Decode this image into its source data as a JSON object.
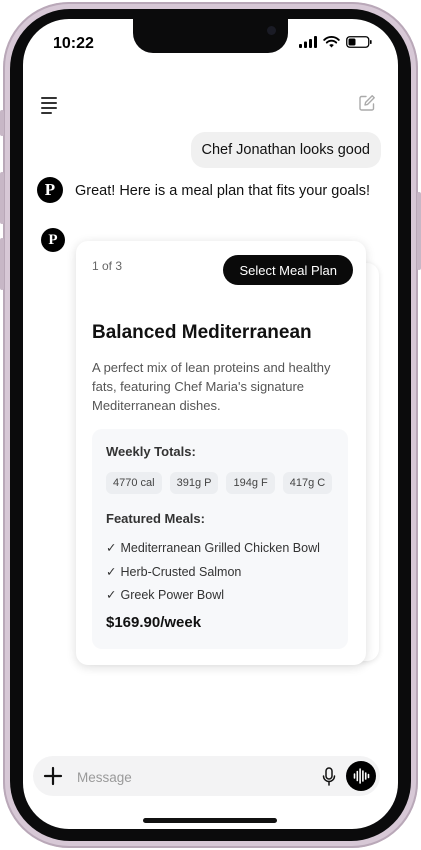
{
  "status_bar": {
    "time": "10:22"
  },
  "chat": {
    "user_message": "Chef Jonathan looks good",
    "assistant_avatar_letter": "P",
    "assistant_message": "Great! Here is a meal plan that fits your goals!"
  },
  "meal_card": {
    "page_indicator": "1 of 3",
    "select_label": "Select Meal Plan",
    "title": "Balanced Mediterranean",
    "description": "A perfect mix of lean proteins and healthy fats, featuring Chef Maria's signature Mediterranean dishes.",
    "weekly_totals_label": "Weekly Totals:",
    "totals": [
      "4770 cal",
      "391g P",
      "194g F",
      "417g C"
    ],
    "featured_label": "Featured Meals:",
    "check_glyph": "✓",
    "meals": [
      "Mediterranean Grilled Chicken Bowl",
      "Herb-Crusted Salmon",
      "Greek Power Bowl"
    ],
    "price": "$169.90/week"
  },
  "composer": {
    "placeholder": "Message"
  },
  "icons": [
    "menu-icon",
    "compose-icon",
    "plus-icon",
    "microphone-icon",
    "voice-waveform-icon",
    "signal-icon",
    "wifi-icon",
    "battery-icon"
  ],
  "colors": {
    "bubble": "#f0f0f0",
    "button": "#0a0a0a",
    "phone_frame": "#d7c8d6"
  }
}
